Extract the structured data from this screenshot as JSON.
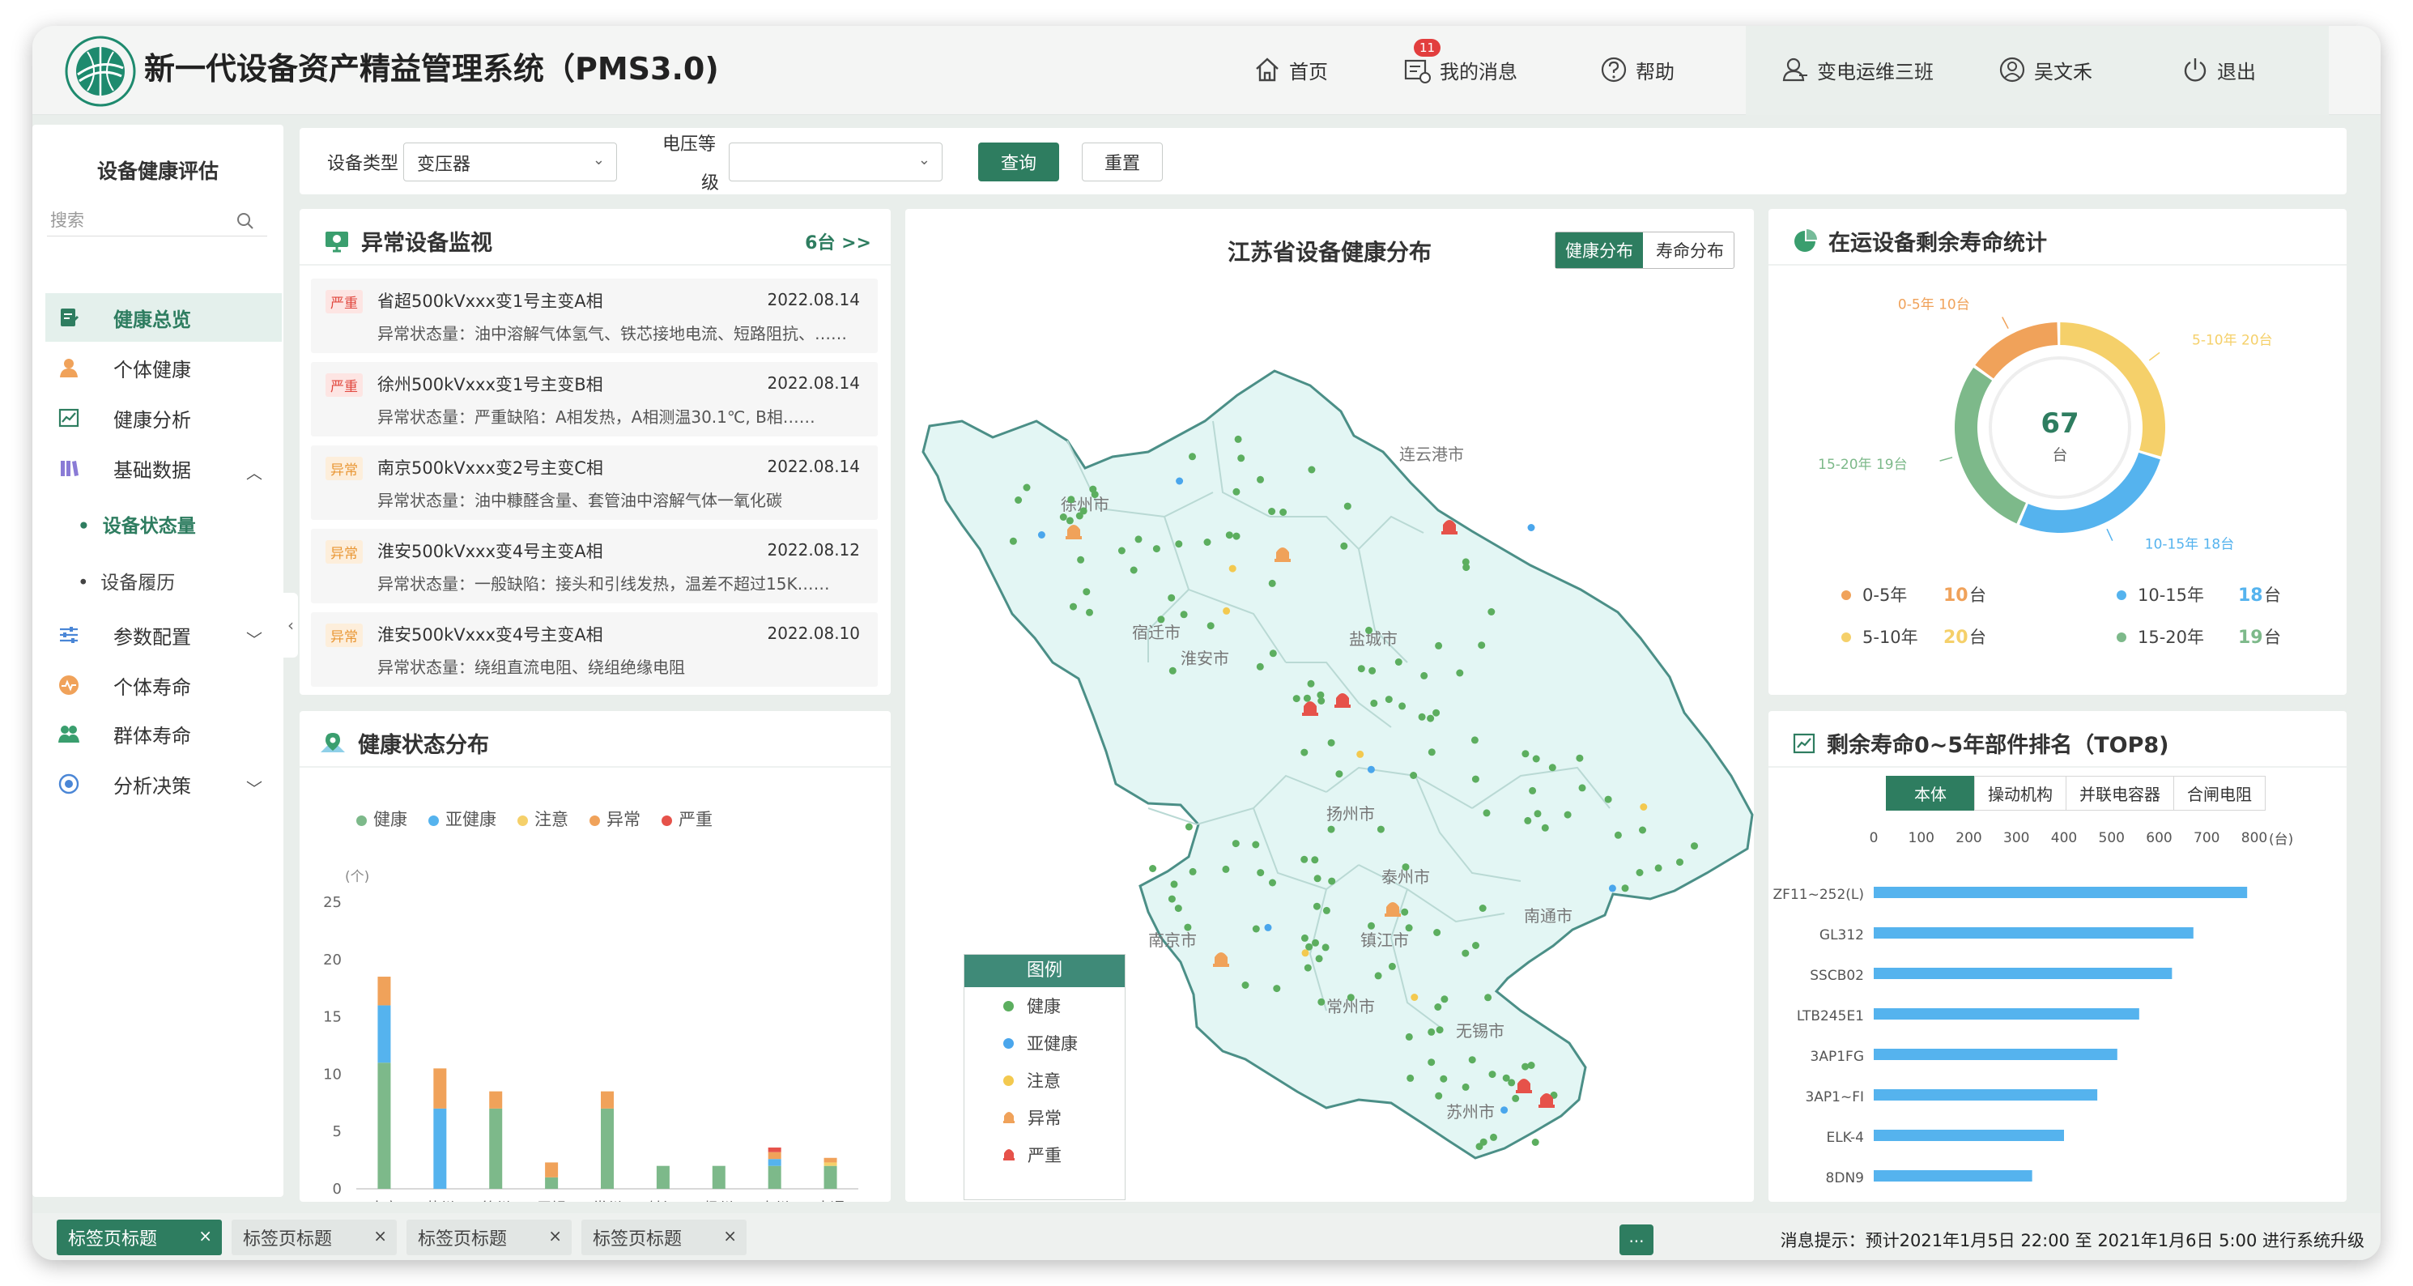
{
  "app": {
    "title": "新一代设备资产精益管理系统（PMS3.0)"
  },
  "nav": {
    "home": "首页",
    "messages": "我的消息",
    "msg_badge": "11",
    "help": "帮助",
    "team": "变电运维三班",
    "user": "吴文禾",
    "logout": "退出"
  },
  "sidebar": {
    "title": "设备健康评估",
    "search_placeholder": "搜索",
    "items": [
      {
        "label": "健康总览",
        "icon": "document-icon"
      },
      {
        "label": "个体健康",
        "icon": "person-icon"
      },
      {
        "label": "健康分析",
        "icon": "chart-icon"
      },
      {
        "label": "基础数据",
        "icon": "books-icon"
      },
      {
        "label": "参数配置",
        "icon": "sliders-icon"
      },
      {
        "label": "个体寿命",
        "icon": "pulse-icon"
      },
      {
        "label": "群体寿命",
        "icon": "group-icon"
      },
      {
        "label": "分析决策",
        "icon": "target-icon"
      }
    ],
    "sub": [
      "设备状态量",
      "设备履历"
    ]
  },
  "filter": {
    "type_label": "设备类型",
    "type_value": "变压器",
    "voltage_label_1": "电压等",
    "voltage_label_2": "级",
    "voltage_value": "",
    "query": "查询",
    "reset": "重置"
  },
  "abnormal": {
    "title": "异常设备监视",
    "count_link": "6台 >>",
    "items": [
      {
        "tag": "严重",
        "level": "severe",
        "name": "省超500kVxxx变1号主变A相",
        "date": "2022.08.14",
        "desc": "异常状态量：油中溶解气体氢气、铁芯接地电流、短路阻抗、……"
      },
      {
        "tag": "严重",
        "level": "severe",
        "name": "徐州500kVxxx变1号主变B相",
        "date": "2022.08.14",
        "desc": "异常状态量：严重缺陷：A相发热，A相测温30.1℃, B相……"
      },
      {
        "tag": "异常",
        "level": "abn",
        "name": "南京500kVxxx变2号主变C相",
        "date": "2022.08.14",
        "desc": "异常状态量：油中糠醛含量、套管油中溶解气体一氧化碳"
      },
      {
        "tag": "异常",
        "level": "abn",
        "name": "淮安500kVxxx变4号主变A相",
        "date": "2022.08.12",
        "desc": "异常状态量：一般缺陷：接头和引线发热，温差不超过15K……"
      },
      {
        "tag": "异常",
        "level": "abn",
        "name": "淮安500kVxxx变4号主变A相",
        "date": "2022.08.10",
        "desc": "异常状态量：绕组直流电阻、绕组绝缘电阻"
      }
    ]
  },
  "health_dist": {
    "title": "健康状态分布",
    "unit": "(个)",
    "chart_data": {
      "type": "bar",
      "stacked": true,
      "categories": [
        "南京",
        "苏州",
        "徐州",
        "无锡",
        "常州",
        "镇江",
        "扬州",
        "泰州",
        "南通"
      ],
      "ylim": [
        0,
        25
      ],
      "yticks": [
        0,
        5,
        10,
        15,
        20,
        25
      ],
      "series": [
        {
          "name": "健康",
          "color": "#7db98a",
          "values": [
            11,
            0,
            7,
            1,
            7,
            2,
            2,
            2,
            2
          ]
        },
        {
          "name": "亚健康",
          "color": "#55b3ee",
          "values": [
            5,
            7,
            0,
            0,
            0,
            0,
            0,
            0.6,
            0
          ]
        },
        {
          "name": "注意",
          "color": "#f5d06a",
          "values": [
            0,
            0,
            0,
            0,
            0,
            0,
            0,
            0,
            0.3
          ]
        },
        {
          "name": "异常",
          "color": "#f0a25a",
          "values": [
            2.5,
            3.5,
            1.5,
            1.3,
            1.5,
            0,
            0,
            0.6,
            0.4
          ]
        },
        {
          "name": "严重",
          "color": "#e6524a",
          "values": [
            0,
            0,
            0,
            0,
            0,
            0,
            0,
            0.4,
            0
          ]
        }
      ]
    }
  },
  "map": {
    "title": "江苏省设备健康分布",
    "btn_health": "健康分布",
    "btn_life": "寿命分布",
    "cities": [
      "连云港市",
      "徐州市",
      "宿迁市",
      "淮安市",
      "盐城市",
      "扬州市",
      "泰州市",
      "南京市",
      "镇江市",
      "南通市",
      "常州市",
      "无锡市",
      "苏州市"
    ],
    "legend_title": "图例",
    "legend": [
      {
        "label": "健康",
        "color": "#5cae5f"
      },
      {
        "label": "亚健康",
        "color": "#4aa6ec"
      },
      {
        "label": "注意",
        "color": "#f3c94f"
      },
      {
        "label": "异常",
        "color": "#f0a25a"
      },
      {
        "label": "严重",
        "color": "#e6524a"
      }
    ]
  },
  "life": {
    "title": "在运设备剩余寿命统计",
    "total": "67",
    "unit": "台",
    "chart_data": {
      "type": "pie",
      "donut": true,
      "slices": [
        {
          "name": "0-5年",
          "value": 10,
          "color": "#f0a25a",
          "label": "0-5年  10台"
        },
        {
          "name": "5-10年",
          "value": 20,
          "color": "#f5d06a",
          "label": "5-10年  20台"
        },
        {
          "name": "10-15年",
          "value": 18,
          "color": "#55b3ee",
          "label": "10-15年  18台"
        },
        {
          "name": "15-20年",
          "value": 19,
          "color": "#7db98a",
          "label": "15-20年  19台"
        }
      ]
    },
    "legend_unit": "台"
  },
  "rank": {
    "title": "剩余寿命0~5年部件排名（TOP8)",
    "tabs": [
      "本体",
      "操动机构",
      "并联电容器",
      "合闸电阻"
    ],
    "axis_unit": "(台)",
    "chart_data": {
      "type": "bar",
      "orientation": "horizontal",
      "xlim": [
        0,
        800
      ],
      "xticks": [
        0,
        100,
        200,
        300,
        400,
        500,
        600,
        700,
        800
      ],
      "categories": [
        "ZF11~252(L)",
        "GL312",
        "SSCB02",
        "LTB245E1",
        "3AP1FG",
        "3AP1~FI",
        "ELK-4",
        "8DN9"
      ],
      "values": [
        785,
        672,
        627,
        558,
        512,
        470,
        400,
        333
      ],
      "color": "#55b3ee"
    }
  },
  "tabs": {
    "items": [
      "标签页标题",
      "标签页标题",
      "标签页标题",
      "标签页标题"
    ],
    "more": "...",
    "notice": "消息提示：预计2021年1月5日 22:00 至 2021年1月6日 5:00 进行系统升级"
  }
}
